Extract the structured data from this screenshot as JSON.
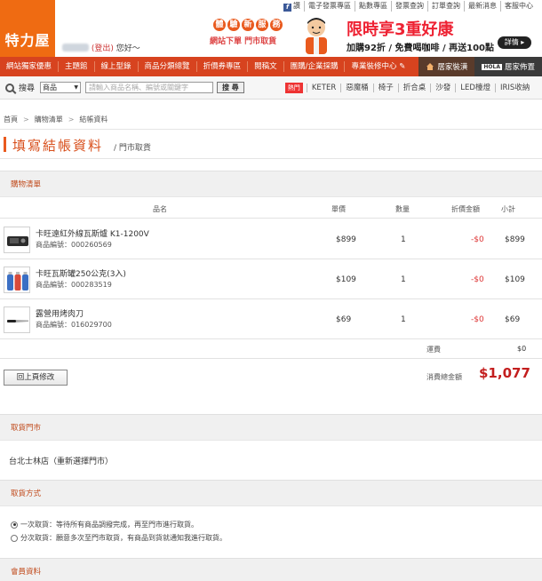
{
  "top_links": [
    "讚",
    "電子發票專區",
    "點數專區",
    "發票查詢",
    "訂單查詢",
    "最新消息",
    "客服中心"
  ],
  "logo": "特力屋",
  "greeting": {
    "logout": "(登出)",
    "hello": "您好～"
  },
  "banner": {
    "experience": [
      "體",
      "驗",
      "新",
      "服",
      "務"
    ],
    "subtitle": "網站下單 門市取貨",
    "headline": "限時享3重好康",
    "offer": "加購92折 / 免費喝咖啡 / 再送100點",
    "detail_button": "詳情"
  },
  "nav": {
    "items": [
      "網站獨家優惠",
      "主題館",
      "線上型錄",
      "商品分類總覽",
      "折價券專區",
      "閱稿文",
      "團購/企業採購",
      "專業裝修中心"
    ],
    "right": [
      {
        "label": "居家裝潢",
        "icon": "house-icon"
      },
      {
        "label": "居家佈置",
        "icon": "hola-logo"
      }
    ]
  },
  "search": {
    "label": "搜尋",
    "scope": "商品",
    "placeholder": "請輸入商品名稱、編號或關鍵字",
    "button": "搜 尋",
    "hot_label": "熱門",
    "hot_keywords": [
      "KETER",
      "惡魔桶",
      "椅子",
      "折合桌",
      "沙發",
      "LED檯燈",
      "IRIS收納"
    ]
  },
  "breadcrumb": [
    "首頁",
    "購物清單",
    "結帳資料"
  ],
  "page_title": "填寫結帳資料",
  "page_subtitle": "/ 門市取貨",
  "cart": {
    "section_title": "購物清單",
    "headers": {
      "name": "品名",
      "price": "單價",
      "qty": "數量",
      "discount": "折價金額",
      "subtotal": "小計"
    },
    "items": [
      {
        "name": "卡旺遠紅外線瓦斯爐 K1-1200V",
        "code_label": "商品編號：000260569",
        "price": "$899",
        "qty": "1",
        "discount": "-$0",
        "subtotal": "$899"
      },
      {
        "name": "卡旺瓦斯罐250公克(3入)",
        "code_label": "商品編號：000283519",
        "price": "$109",
        "qty": "1",
        "discount": "-$0",
        "subtotal": "$109"
      },
      {
        "name": "露營用烤肉刀",
        "code_label": "商品編號：016029700",
        "price": "$69",
        "qty": "1",
        "discount": "-$0",
        "subtotal": "$69"
      }
    ],
    "shipping_label": "運費",
    "shipping_value": "$0",
    "back_button": "回上頁修改",
    "total_label": "消費總金額",
    "total_value": "$1,077"
  },
  "pickup": {
    "section_title": "取貨門市",
    "store": "台北士林店（重新選擇門市）"
  },
  "method": {
    "section_title": "取貨方式",
    "options": [
      {
        "label": "一次取貨：等待所有商品調撥完成，再至門市進行取貨。",
        "checked": true
      },
      {
        "label": "分次取貨：願意多次至門市取貨，有商品到貨就通知我進行取貨。",
        "checked": false
      }
    ]
  },
  "member": {
    "section_title": "會員資料"
  }
}
